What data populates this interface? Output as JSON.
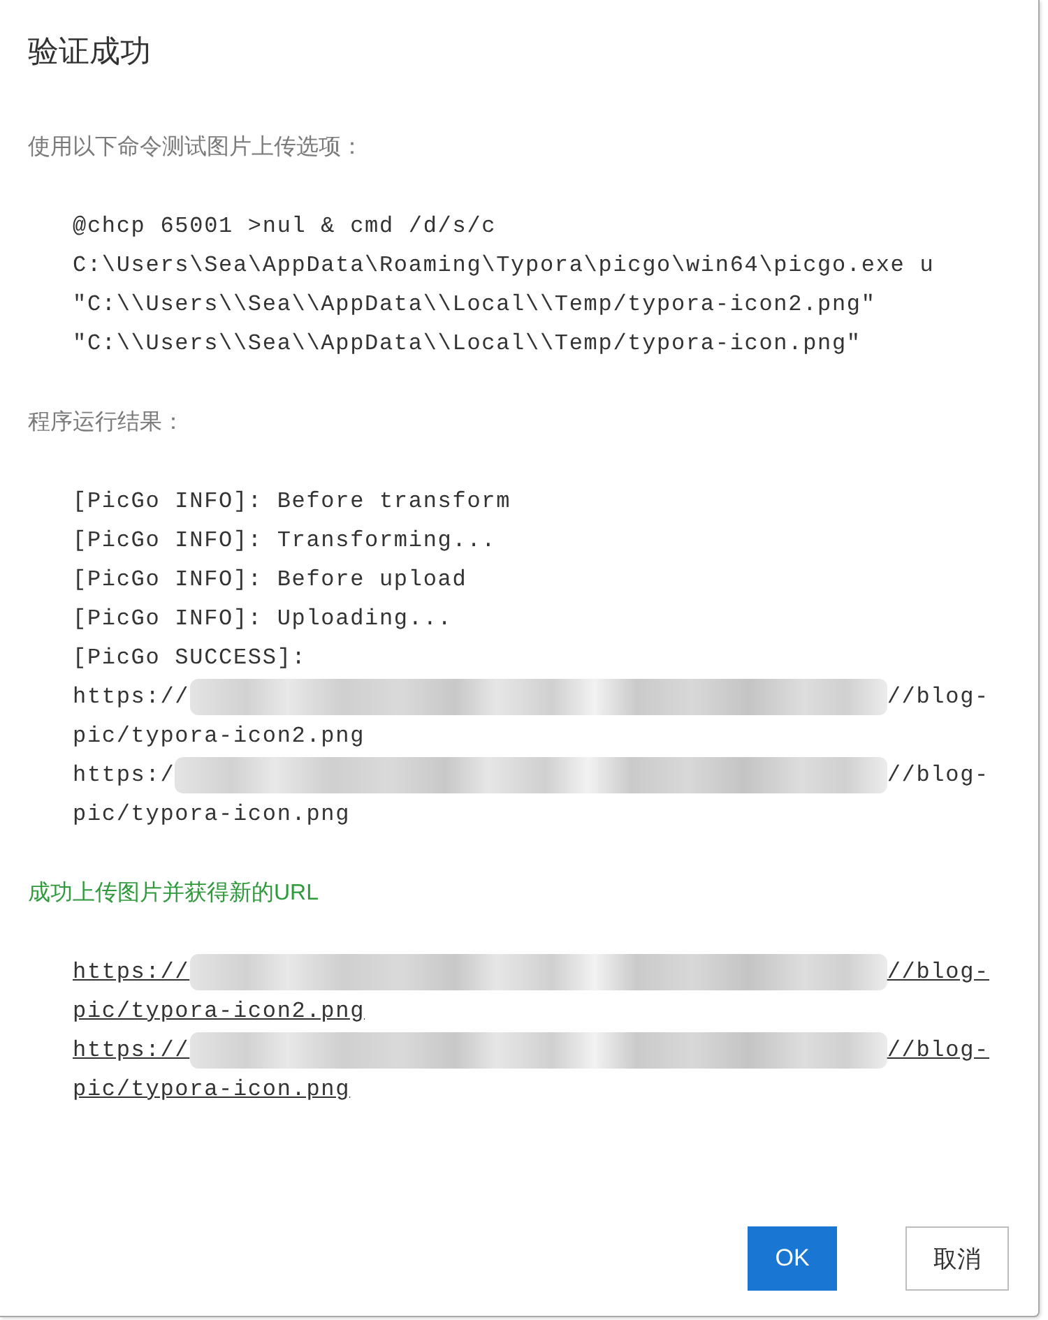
{
  "dialog": {
    "title": "验证成功",
    "sections": [
      {
        "kind": "code",
        "label": "使用以下命令测试图片上传选项：",
        "lines": [
          {
            "kind": "text",
            "text": "@chcp 65001 >nul & cmd /d/s/c"
          },
          {
            "kind": "text",
            "text": "C:\\Users\\Sea\\AppData\\Roaming\\Typora\\picgo\\win64\\picgo.exe u"
          },
          {
            "kind": "text",
            "text": "\"C:\\\\Users\\\\Sea\\\\AppData\\\\Local\\\\Temp/typora-icon2.png\""
          },
          {
            "kind": "text",
            "text": "\"C:\\\\Users\\\\Sea\\\\AppData\\\\Local\\\\Temp/typora-icon.png\""
          }
        ]
      },
      {
        "kind": "log",
        "label": "程序运行结果：",
        "lines": [
          {
            "kind": "text",
            "text": "[PicGo INFO]: Before transform"
          },
          {
            "kind": "text",
            "text": "[PicGo INFO]: Transforming..."
          },
          {
            "kind": "text",
            "text": "[PicGo INFO]: Before upload"
          },
          {
            "kind": "text",
            "text": "[PicGo INFO]: Uploading..."
          },
          {
            "kind": "text",
            "text": "[PicGo SUCCESS]:"
          },
          {
            "kind": "redacted",
            "before": "https://",
            "after": "//blog-"
          },
          {
            "kind": "text",
            "text": "pic/typora-icon2.png"
          },
          {
            "kind": "redacted",
            "before": "https:/",
            "after": "//blog-"
          },
          {
            "kind": "text",
            "text": "pic/typora-icon.png"
          }
        ]
      },
      {
        "kind": "links",
        "label": "成功上传图片并获得新的URL",
        "lines": [
          {
            "kind": "redacted",
            "before": "https://",
            "after": "//blog-"
          },
          {
            "kind": "text",
            "text": "pic/typora-icon2.png"
          },
          {
            "kind": "redacted",
            "before": "https://",
            "after": "//blog-"
          },
          {
            "kind": "text",
            "text": "pic/typora-icon.png"
          }
        ]
      }
    ],
    "buttons": [
      {
        "kind": "primary",
        "label": "OK"
      },
      {
        "kind": "secondary",
        "label": "取消"
      }
    ]
  }
}
